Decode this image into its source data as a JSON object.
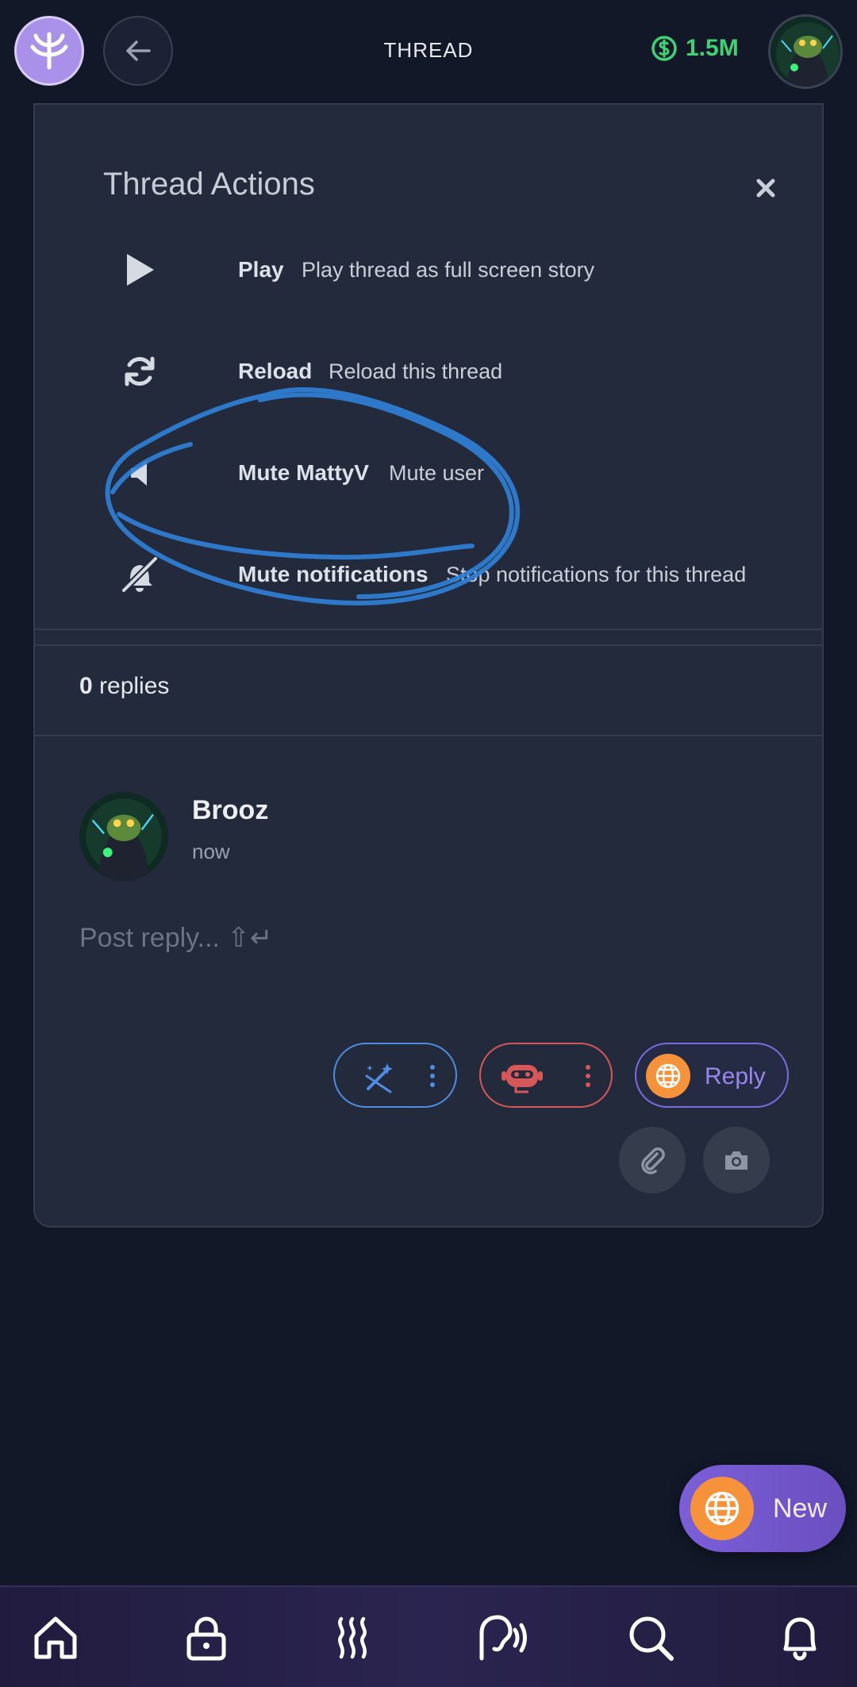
{
  "header": {
    "title": "THREAD",
    "balance": "1.5M",
    "logo_icon": "app-logo-icon",
    "back_icon": "arrow-left-icon",
    "balance_color": "#3ed274"
  },
  "thread_actions": {
    "title": "Thread Actions",
    "close_icon": "close-icon",
    "items": [
      {
        "icon": "play-icon",
        "label": "Play",
        "description": "Play thread as full screen story"
      },
      {
        "icon": "reload-icon",
        "label": "Reload",
        "description": "Reload this thread"
      },
      {
        "icon": "speaker-icon",
        "label": "Mute MattyV",
        "description": "Mute user"
      },
      {
        "icon": "bell-off-icon",
        "label": "Mute notifications",
        "description": "Stop notifications for this thread"
      }
    ]
  },
  "replies": {
    "count": "0",
    "label": "replies"
  },
  "post": {
    "author": "Brooz",
    "time": "now",
    "placeholder": "Post reply... ⇧↵"
  },
  "composer": {
    "magic_icon": "magic-wand-icon",
    "bot_icon": "robot-icon",
    "reply_label": "Reply",
    "globe_icon": "globe-icon",
    "attach_icon": "paperclip-icon",
    "camera_icon": "camera-icon",
    "colors": {
      "magic": "#4f8de0",
      "bot": "#d65757",
      "reply": "#9b86f0",
      "globe": "#f5923a"
    }
  },
  "fab": {
    "label": "New",
    "icon": "globe-icon"
  },
  "nav": [
    {
      "icon": "home-icon"
    },
    {
      "icon": "lock-icon"
    },
    {
      "icon": "heat-waves-icon"
    },
    {
      "icon": "voice-icon"
    },
    {
      "icon": "search-icon"
    },
    {
      "icon": "bell-icon"
    }
  ]
}
